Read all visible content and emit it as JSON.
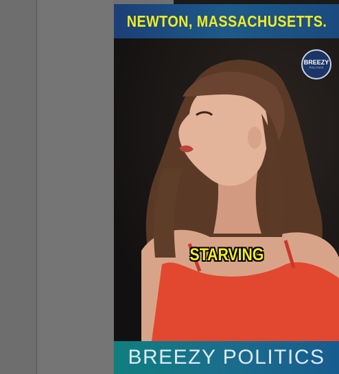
{
  "video": {
    "title": "NEWTON, MASSACHUSETTS.",
    "caption": "STARVING",
    "badge": {
      "main": "BREEZY",
      "sub": "POLITICS"
    },
    "footer": "BREEZY  POLITICS"
  },
  "colors": {
    "title_text": "#f2ea21",
    "title_bar": "#1b3f76",
    "footer_bar": "#0f7f7e",
    "canvas_bg": "#707070"
  }
}
